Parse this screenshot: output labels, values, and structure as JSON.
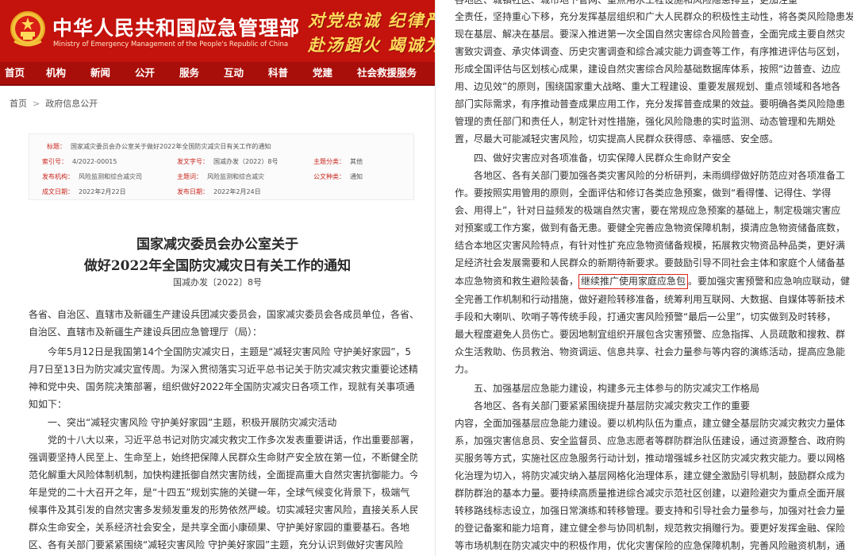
{
  "header": {
    "ministry_cn": "中华人民共和国应急管理部",
    "ministry_en": "Ministry of Emergency Management of the People's Republic of China",
    "slogan_line1": "对党忠诚  纪律严明",
    "slogan_line2": "赴汤蹈火  竭诚为民",
    "colors": {
      "banner": "#c4120c",
      "nav": "#a90f0a",
      "slogan": "#ffd95a",
      "highlight_box": "#e0241b"
    }
  },
  "nav": [
    "首页",
    "机构",
    "新闻",
    "公开",
    "服务",
    "互动",
    "科普",
    "党建",
    "社会救援服务"
  ],
  "breadcrumb": {
    "home": "首页",
    "separator": ">",
    "current": "政府信息公开"
  },
  "meta": {
    "title_label": "标题：",
    "title_value": "国家减灾委员会办公室关于做好2022年全国防灾减灾日有关工作的通知",
    "index_label": "索引号：",
    "index_value": "4/2022-00015",
    "category_label": "发文字号：",
    "category_value": "国减办发（2022）8号",
    "topic_label": "主题分类：",
    "topic_value": "其他",
    "org_label": "发布机构：",
    "org_value": "风险监测和综合减灾司",
    "issuer_label": "主题词：",
    "issuer_value": "风险监测和综合减灾",
    "public_label": "公文种类：",
    "public_value": "通知",
    "date_label": "成文日期：",
    "date_value": "2022年2月22日",
    "publish_label": "发布日期：",
    "publish_value": "2022年2月24日"
  },
  "doc": {
    "title_line1": "国家减灾委员会办公室关于",
    "title_line2": "做好2022年全国防灾减灾日有关工作的通知",
    "doc_number": "国减办发〔2022〕8号"
  },
  "left_lines": [
    "各省、自治区、直辖市及新疆生产建设兵团减灾委员会，国家减灾委员会各成员单位，各省、",
    "自治区、直辖市及新疆生产建设兵团应急管理厅（局）：",
    "　　今年5月12日是我国第14个全国防灾减灾日，主题是“减轻灾害风险  守护美好家园”，5",
    "月7日至13日为防灾减灾宣传周。为深入贯彻落实习近平总书记关于防灾减灾救灾重要论述精",
    "神和党中央、国务院决策部署，组织做好2022年全国防灾减灾日各项工作，现就有关事项通",
    "知如下：",
    "　　一、突出“减轻灾害风险  守护美好家园”主题，积极开展防灾减灾活动",
    "　　党的十八大以来，习近平总书记对防灾减灾救灾工作多次发表重要讲话，作出重要部署，",
    "强调要坚持人民至上、生命至上，始终把保障人民群众生命财产安全放在第一位，不断健全防",
    "范化解重大风险体制机制，加快构建抵御自然灾害防线，全面提高重大自然灾害抗御能力。今",
    "年是党的二十大召开之年，是“十四五”规划实施的关键一年，全球气候变化背景下，极端气",
    "候事件及其引发的自然灾害多发频发重发的形势依然严峻。切实减轻灾害风险，直接关系人民",
    "群众生命安全，关系经济社会安全，是共享全面小康硕果、守护美好家园的重要基石。各地",
    "区、各有关部门要紧紧围绕“减轻灾害风险  守护美好家园”主题，充分认识到做好灾害风险"
  ],
  "right_lines": [
    "各地区、城镇社区、城市地下管网、重点用水工程设施和风险隐患排查，更加注重",
    "全责任，坚持重心下移，充分发挥基层组织和广大人民群众的积极性主动性，将各类风险隐患发",
    "现在基层、解决在基层。要深入推进第一次全国自然灾害综合风险普查，全面完成主要自然灾",
    "害致灾调查、承灾体调查、历史灾害调查和综合减灾能力调查等工作，有序推进评估与区划，",
    "形成全国评估与区划核心成果，建设自然灾害综合风险基础数据库体系，按照“边普查、边应",
    "用、边见效”的原则，围绕国家重大战略、重大工程建设、重要发展规划、重点领域和各地各",
    "部门实际需求，有序推动普查成果应用工作，充分发挥普查成果的效益。要明确各类风险隐患",
    "管理的责任部门和责任人，制定针对性措施，强化风险隐患的实时监测、动态管理和先期处",
    "置，尽最大可能减轻灾害风险，切实提高人民群众获得感、幸福感、安全感。",
    "　　四、做好灾害应对各项准备，切实保障人民群众生命财产安全",
    "　　各地区、各有关部门要加强各类灾害风险的分析研判，未雨绸缪做好防范应对各项准备工",
    "作。要按照实用管用的原则，全面评估和修订各类应急预案，做到“看得懂、记得住、学得",
    "会、用得上”，针对日益频发的极端自然灾害，要在常规应急预案的基础上，制定极端灾害应",
    "对预案或工作方案，做到有备无患。要健全完善应急物资保障机制，摸清应急物资储备底数，",
    "结合本地区灾害风险特点，有针对性扩充应急物资储备规模，拓展救灾物资品种品类，更好满",
    "足经济社会发展需要和人民群众的新期待新要求。要鼓励引导不同社会主体和家庭个人储备基"
  ],
  "right_hl": {
    "before": "本应急物资和救生避险装备，",
    "highlight": "继续推广使用家庭应急包",
    "after": "。要加强灾害预警和应急响应联动，健"
  },
  "right_lines2": [
    "全完善工作机制和行动措施，做好避险转移准备，统筹利用互联网、大数据、自媒体等新技术",
    "手段和大喇叭、吹哨子等传统手段，打通灾害风险预警“最后一公里”，切实做到及时转移，",
    "最大程度避免人员伤亡。要因地制宜组织开展包含灾害预警、应急指挥、人员疏散和搜救、群",
    "众生活救助、伤员救治、物资调运、信息共享、社会力量参与等内容的演练活动，提高应急能",
    "力。",
    "　　五、加强基层应急能力建设，构建多元主体参与的防灾减灾工作格局",
    "　　各地区、各有关部门要紧紧围绕提升基层防灾减灾救灾工作的重要",
    "内容，全面加强基层应急能力建设。要以机构队伍为重点，建立健全基层防灾减灾救灾力量体",
    "系，加强灾害信息员、安全监督员、应急志愿者等群防群治队伍建设，通过资源整合、政府购",
    "买服务等方式，实施社区应急服务行动计划，推动增强城乡社区防灾减灾救灾能力。要以网格",
    "化治理为切入，将防灾减灾纳入基层网格化治理体系，建立健全激励引导机制，鼓励群众成为",
    "群防群治的基本力量。要持续高质量推进综合减灾示范社区创建，以避险避灾为重点全面开展",
    "转移路线标志设立，加强日常演练和转移管理。要支持和引导社会力量参与，加强对社会力量",
    "的登记备案和能力培育，建立健全参与协同机制，规范救灾捐赠行为。要更好发挥金融、保险",
    "等市场机制在防灾减灾中的积极作用，优化灾害保险的应急保障机制，完善风险融资机制，通"
  ]
}
